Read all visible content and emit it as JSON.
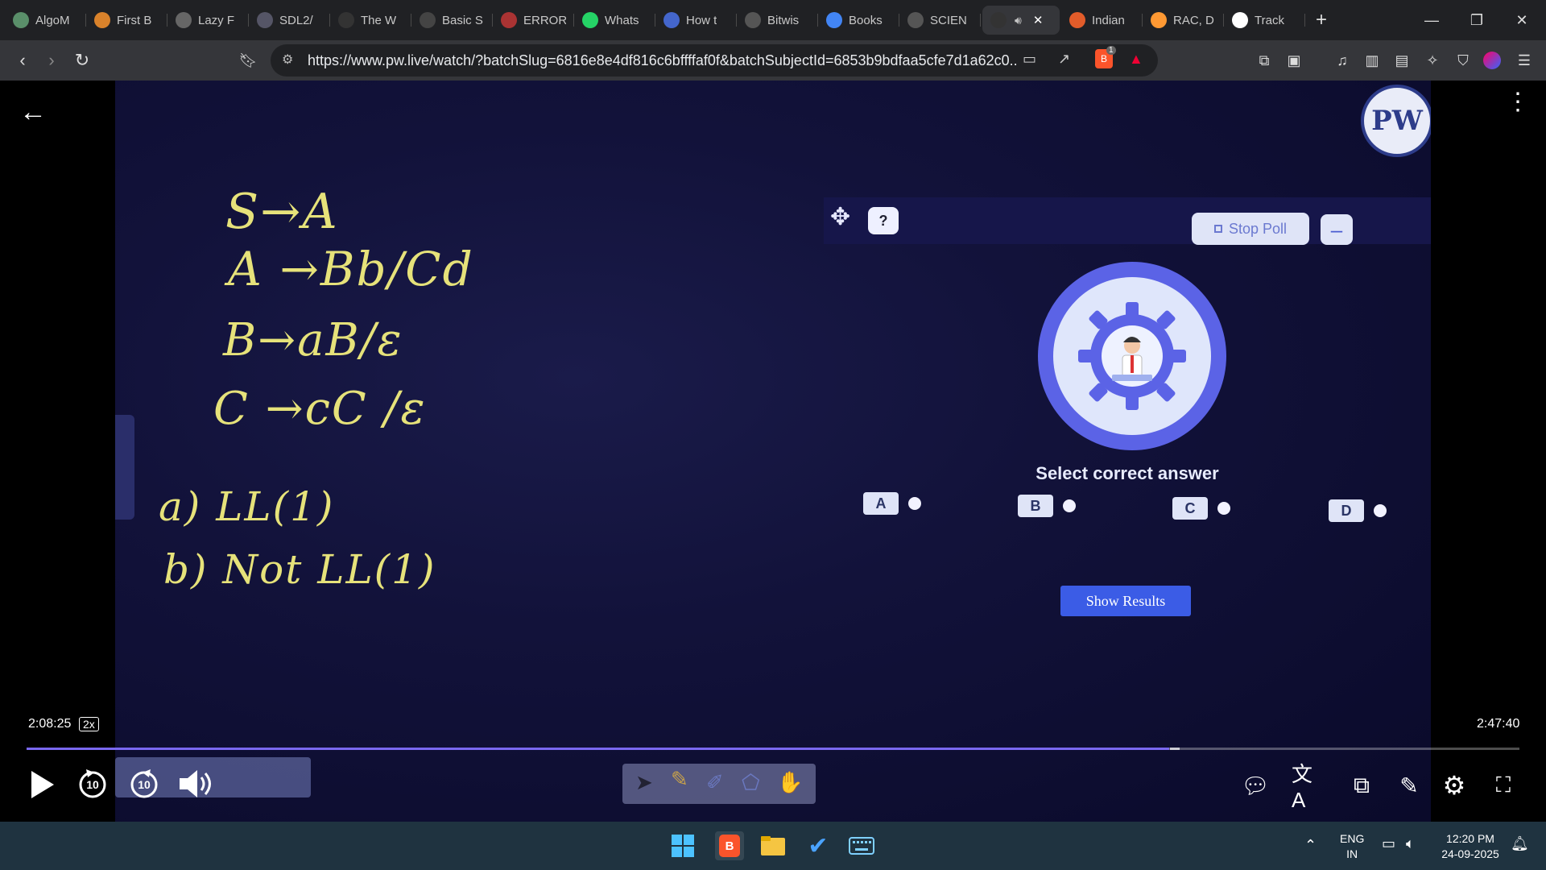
{
  "browser": {
    "tabs": [
      {
        "label": "AlgoM",
        "icon": "globe-icon",
        "color": "#5a8f6a"
      },
      {
        "label": "First B",
        "icon": "lightning-icon",
        "color": "#d9822b"
      },
      {
        "label": "Lazy F",
        "icon": "globe-icon",
        "color": "#666"
      },
      {
        "label": "SDL2/",
        "icon": "globe-icon",
        "color": "#556"
      },
      {
        "label": "The W",
        "icon": "w-icon",
        "color": "#333"
      },
      {
        "label": "Basic S",
        "icon": "doc-icon",
        "color": "#444"
      },
      {
        "label": "ERROR",
        "icon": "globe-icon",
        "color": "#a33"
      },
      {
        "label": "Whats",
        "icon": "whatsapp-icon",
        "color": "#25d366"
      },
      {
        "label": "How t",
        "icon": "globe-icon",
        "color": "#4466cc"
      },
      {
        "label": "Bitwis",
        "icon": "text-icon",
        "color": "#555"
      },
      {
        "label": "Books",
        "icon": "google-icon",
        "color": "#4285f4"
      },
      {
        "label": "SCIEN",
        "icon": "globe-icon",
        "color": "#555"
      },
      {
        "label": "",
        "icon": "audio-icon",
        "color": "#333",
        "active": true
      },
      {
        "label": "Indian",
        "icon": "globe-icon",
        "color": "#e25c2a"
      },
      {
        "label": "RAC, D",
        "icon": "flag-icon",
        "color": "#ff9933"
      },
      {
        "label": "Track",
        "icon": "amazon-icon",
        "color": "#fff"
      }
    ],
    "url": "https://www.pw.live/watch/?batchSlug=6816e8e4df816c6bffffaf0f&batchSubjectId=6853b9bdfaa5cfe7d1a62c0...",
    "brave_badge": "1"
  },
  "video": {
    "handwriting": {
      "line1": "S→A",
      "line2": "A →Bb/Cd",
      "line3": "B→aB/ε",
      "line4": "C →cC /ε",
      "option_a": "a) LL(1)",
      "option_b": "b) Not LL(1)"
    },
    "poll": {
      "stop_label": "Stop Poll",
      "minus_label": "–",
      "help_label": "?",
      "title": "Select correct answer",
      "options": [
        "A",
        "B",
        "C",
        "D"
      ],
      "show_results_label": "Show Results"
    },
    "logo_text": "PW"
  },
  "player": {
    "current_time": "2:08:25",
    "speed": "2x",
    "duration": "2:47:40",
    "progress_fraction": 0.7653,
    "rewind_label": "10",
    "forward_label": "10",
    "accent_color": "#7a68f0"
  },
  "taskbar": {
    "lang_line1": "ENG",
    "lang_line2": "IN",
    "time": "12:20 PM",
    "date": "24-09-2025"
  }
}
